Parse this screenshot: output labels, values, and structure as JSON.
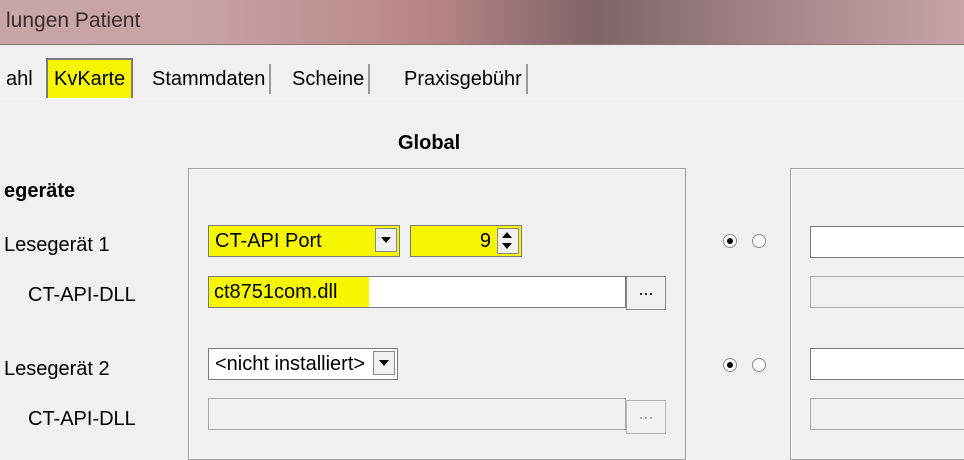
{
  "window": {
    "title": "lungen Patient"
  },
  "tabs": [
    {
      "label": "ahl"
    },
    {
      "label": "KvKarte",
      "active": true
    },
    {
      "label": "Stammdaten"
    },
    {
      "label": "Scheine"
    },
    {
      "label": "Praxisgebühr"
    }
  ],
  "section": {
    "heading": "Global",
    "group_label": "egeräte"
  },
  "reader1": {
    "label": "Lesegerät 1",
    "port_type": "CT-API Port",
    "port_number": "9",
    "dll_label": "CT-API-DLL",
    "dll_value": "ct8751com.dll",
    "browse_label": "...",
    "radio_selected": 0
  },
  "reader2": {
    "label": "Lesegerät 2",
    "port_type": "<nicht installiert>",
    "dll_label": "CT-API-DLL",
    "dll_value": "",
    "browse_label": "...",
    "radio_selected": 0
  },
  "colors": {
    "highlight": "#f6f600",
    "title_bar": "#c9a3a5"
  }
}
